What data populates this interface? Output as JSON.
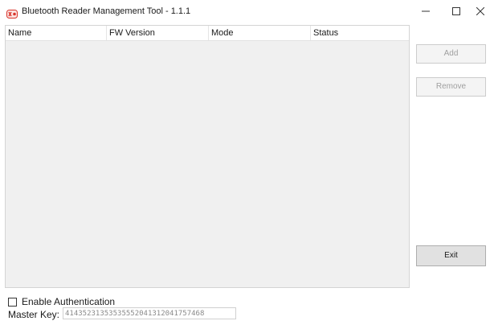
{
  "window": {
    "title": "Bluetooth Reader Management Tool - 1.1.1",
    "app_icon": "bluetooth-reader-icon",
    "controls": {
      "minimize_icon": "minimize-icon",
      "maximize_icon": "maximize-icon",
      "close_icon": "close-icon"
    }
  },
  "list": {
    "columns": [
      "Name",
      "FW Version",
      "Mode",
      "Status"
    ],
    "rows": []
  },
  "buttons": {
    "add": "Add",
    "remove": "Remove",
    "exit": "Exit"
  },
  "auth": {
    "enable_label": "Enable Authentication",
    "enabled": false,
    "master_key_label": "Master Key:",
    "master_key_value": "41435231353535552041312041757468"
  },
  "colors": {
    "list_background": "#f0f0f0",
    "app_icon_red": "#d9342b"
  }
}
